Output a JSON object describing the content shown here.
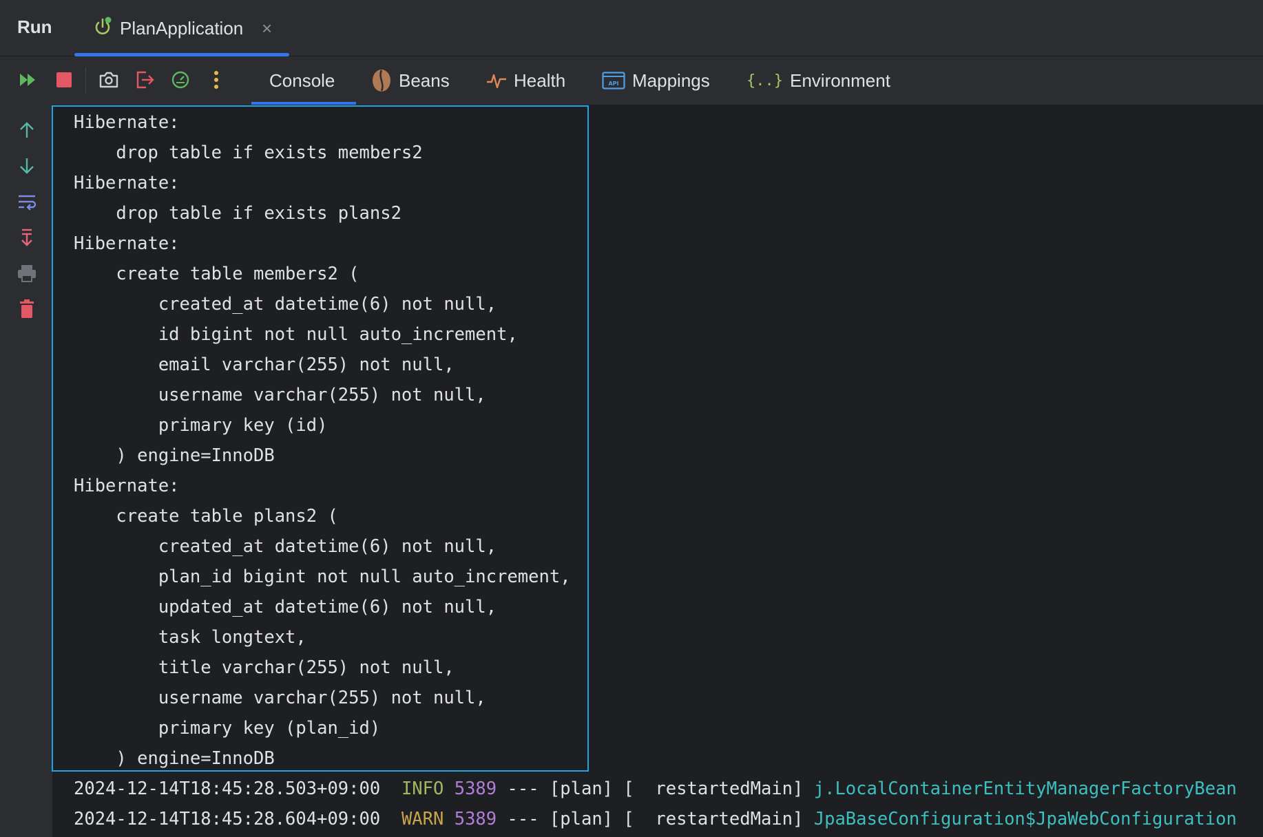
{
  "header": {
    "panel_label": "Run",
    "app_tab": {
      "label": "PlanApplication",
      "close": "×"
    }
  },
  "toolbar": {
    "tabs": [
      {
        "label": "Console",
        "icon": "console",
        "active": true
      },
      {
        "label": "Beans",
        "icon": "bean-icon"
      },
      {
        "label": "Health",
        "icon": "pulse-icon"
      },
      {
        "label": "Mappings",
        "icon": "api-icon"
      },
      {
        "label": "Environment",
        "icon": "braces-icon"
      }
    ],
    "api_badge": "API",
    "env_glyph": "{..}"
  },
  "console": {
    "lines": [
      "Hibernate: ",
      "    drop table if exists members2",
      "Hibernate: ",
      "    drop table if exists plans2",
      "Hibernate: ",
      "    create table members2 (",
      "        created_at datetime(6) not null,",
      "        id bigint not null auto_increment,",
      "        email varchar(255) not null,",
      "        username varchar(255) not null,",
      "        primary key (id)",
      "    ) engine=InnoDB",
      "Hibernate: ",
      "    create table plans2 (",
      "        created_at datetime(6) not null,",
      "        plan_id bigint not null auto_increment,",
      "        updated_at datetime(6) not null,",
      "        task longtext,",
      "        title varchar(255) not null,",
      "        username varchar(255) not null,",
      "        primary key (plan_id)",
      "    ) engine=InnoDB"
    ],
    "log_lines": [
      {
        "timestamp": "2024-12-14T18:45:28.503+09:00",
        "level": "INFO",
        "pid": "5389",
        "middle": "--- [plan] [  restartedMain]",
        "logger": "j.LocalContainerEntityManagerFactoryBean"
      },
      {
        "timestamp": "2024-12-14T18:45:28.604+09:00",
        "level": "WARN",
        "pid": "5389",
        "middle": "--- [plan] [  restartedMain]",
        "logger": "JpaBaseConfiguration$JpaWebConfiguration"
      }
    ]
  },
  "colors": {
    "accent": "#3574f0",
    "selection_border": "#1ea5e4",
    "info": "#a2b860",
    "warn": "#c8a44a",
    "pid": "#b07ed6",
    "logger": "#3dbfbf"
  }
}
